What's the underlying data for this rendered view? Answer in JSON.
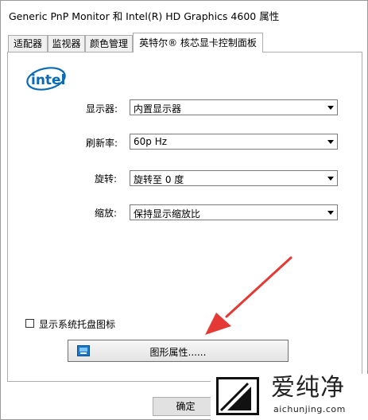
{
  "window": {
    "title": "Generic PnP Monitor 和 Intel(R) HD Graphics 4600 属性"
  },
  "tabs": [
    {
      "label": "适配器"
    },
    {
      "label": "监视器"
    },
    {
      "label": "颜色管理"
    },
    {
      "label": "英特尔® 核芯显卡控制面板",
      "active": true
    }
  ],
  "panel": {
    "logo_text": "intel",
    "fields": [
      {
        "label": "显示器:",
        "value": "内置显示器"
      },
      {
        "label": "刷新率:",
        "value": "60p Hz"
      },
      {
        "label": "旋转:",
        "value": "旋转至 0 度"
      },
      {
        "label": "缩放:",
        "value": "保持显示缩放比"
      }
    ],
    "tray_checkbox": {
      "label": "显示系统托盘图标",
      "checked": false
    },
    "graphics_button": {
      "label": "图形属性......"
    }
  },
  "footer": {
    "ok_label": "确定"
  },
  "watermark": {
    "big_text": "爱纯净",
    "small_text": "aichunjing.com"
  },
  "colors": {
    "annotation_arrow": "#e53935",
    "intel_blue": "#0a6bb4"
  }
}
